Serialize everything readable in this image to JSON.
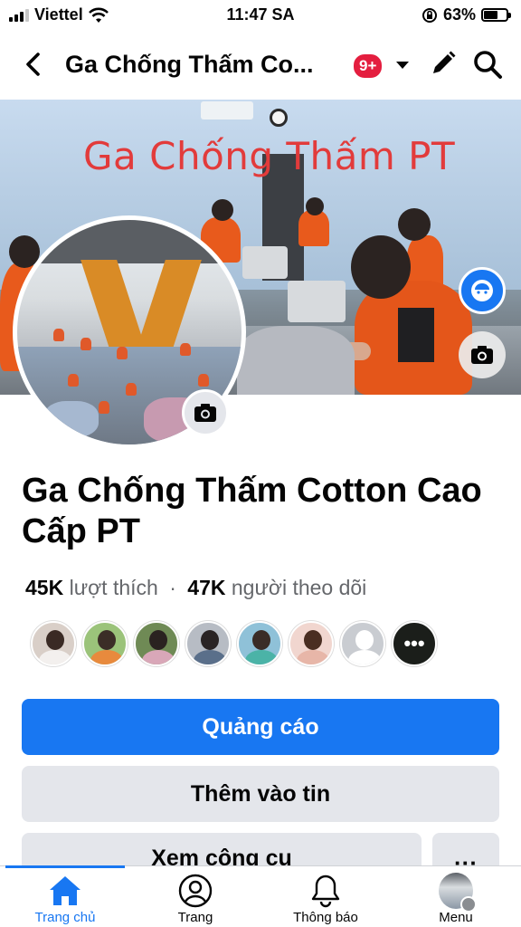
{
  "status_bar": {
    "carrier": "Viettel",
    "time": "11:47 SA",
    "battery": "63%",
    "battery_level": 0.63
  },
  "header": {
    "title": "Ga Chống Thấm Co...",
    "badge": "9+",
    "icons": [
      "back-arrow-icon",
      "chevron-down-icon",
      "pencil-icon",
      "search-icon"
    ]
  },
  "cover": {
    "sign_text": "Ga Chống Thấm PT"
  },
  "page": {
    "name": "Ga Chống Thấm Cotton Cao Cấp PT",
    "likes_count": "45K",
    "likes_label": "lượt thích",
    "separator": "·",
    "followers_count": "47K",
    "followers_label": "người theo dõi"
  },
  "buttons": {
    "primary": "Quảng cáo",
    "add_to_story": "Thêm vào tin",
    "tools": "Xem công cụ",
    "more": "···"
  },
  "tabs": [
    {
      "label": "Trang chủ",
      "icon": "home-icon",
      "active": true
    },
    {
      "label": "Trang",
      "icon": "profile-icon",
      "active": false
    },
    {
      "label": "Thông báo",
      "icon": "bell-icon",
      "active": false
    },
    {
      "label": "Menu",
      "icon": "avatar-menu-icon",
      "active": false
    }
  ],
  "colors": {
    "accent": "#1877f2",
    "badge": "#e41e3f",
    "secondary_button": "#e4e6eb"
  }
}
